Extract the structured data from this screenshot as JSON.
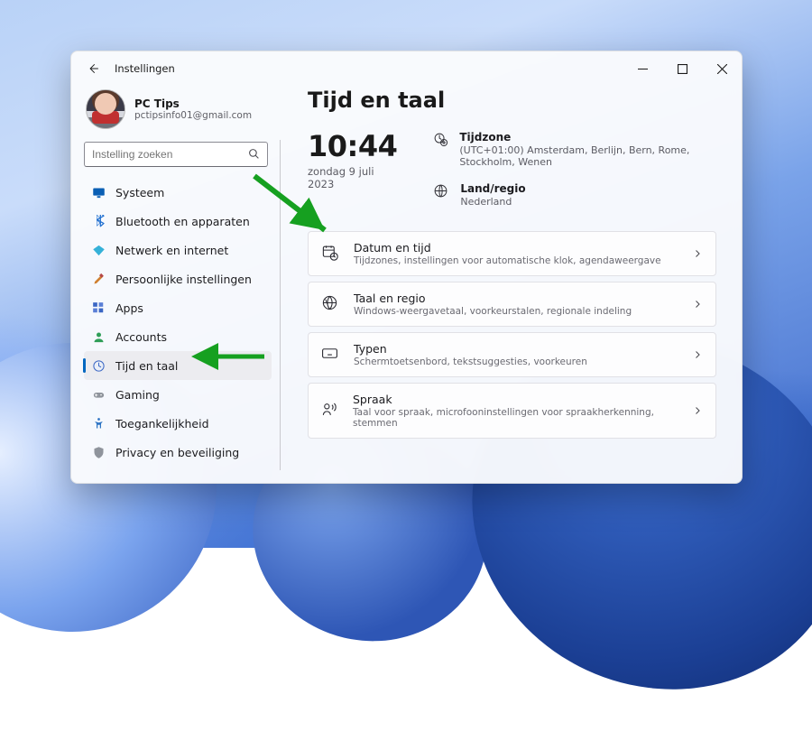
{
  "window": {
    "title": "Instellingen"
  },
  "profile": {
    "name": "PC Tips",
    "email": "pctipsinfo01@gmail.com"
  },
  "search": {
    "placeholder": "Instelling zoeken"
  },
  "sidebar": {
    "items": [
      {
        "icon": "display",
        "label": "Systeem"
      },
      {
        "icon": "bluetooth",
        "label": "Bluetooth en apparaten"
      },
      {
        "icon": "wifi",
        "label": "Netwerk en internet"
      },
      {
        "icon": "brush",
        "label": "Persoonlijke instellingen"
      },
      {
        "icon": "apps",
        "label": "Apps"
      },
      {
        "icon": "person",
        "label": "Accounts"
      },
      {
        "icon": "clock",
        "label": "Tijd en taal"
      },
      {
        "icon": "game",
        "label": "Gaming"
      },
      {
        "icon": "accessibility",
        "label": "Toegankelijkheid"
      },
      {
        "icon": "shield",
        "label": "Privacy en beveiliging"
      }
    ],
    "active_index": 6
  },
  "main": {
    "heading": "Tijd en taal",
    "time": "10:44",
    "date": "zondag 9 juli 2023",
    "info": [
      {
        "label": "Tijdzone",
        "value": "(UTC+01:00) Amsterdam, Berlijn, Bern, Rome, Stockholm, Wenen"
      },
      {
        "label": "Land/regio",
        "value": "Nederland"
      }
    ],
    "cards": [
      {
        "title": "Datum en tijd",
        "desc": "Tijdzones, instellingen voor automatische klok, agendaweergave"
      },
      {
        "title": "Taal en regio",
        "desc": "Windows-weergavetaal, voorkeurstalen, regionale indeling"
      },
      {
        "title": "Typen",
        "desc": "Schermtoetsenbord, tekstsuggesties, voorkeuren"
      },
      {
        "title": "Spraak",
        "desc": "Taal voor spraak, microfooninstellingen voor spraakherkenning, stemmen"
      }
    ]
  }
}
